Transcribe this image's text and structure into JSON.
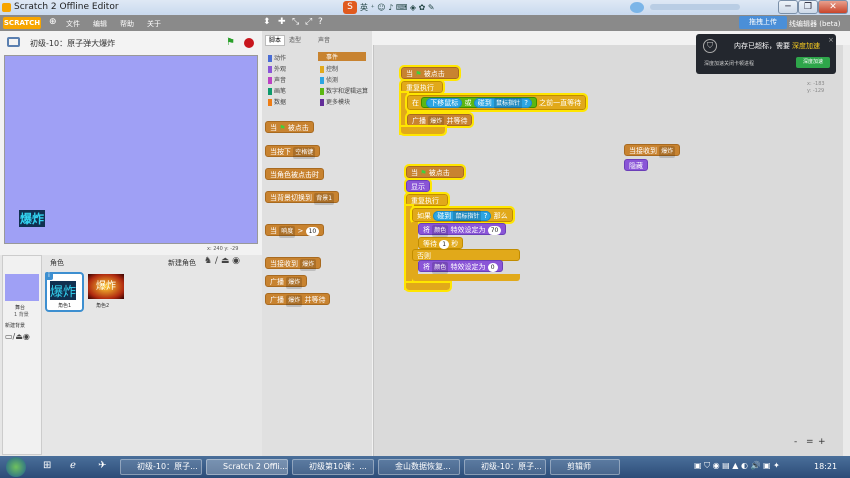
{
  "window": {
    "title": "Scratch 2 Offline Editor"
  },
  "menu": {
    "logo": "SCRATCH",
    "items": [
      "文件",
      "编辑",
      "帮助",
      "关于"
    ]
  },
  "project": {
    "title": "初级-10：原子弹大爆炸"
  },
  "stage": {
    "sprite_text": "爆炸",
    "coords": "x: 240  y: -29"
  },
  "sprites": {
    "header": "角色",
    "new_sprite": "新建角色",
    "list": [
      {
        "name": "角色1",
        "text": "爆炸"
      },
      {
        "name": "角色2",
        "text": "爆炸"
      }
    ],
    "stage_label": "舞台",
    "stage_sub": "1 背景",
    "new_backdrop": "新建背景"
  },
  "tabs": [
    "脚本",
    "造型",
    "声音"
  ],
  "categories": [
    {
      "label": "动作",
      "color": "#4a6cd4"
    },
    {
      "label": "事件",
      "color": "#c88330"
    },
    {
      "label": "外观",
      "color": "#8a55d7"
    },
    {
      "label": "控制",
      "color": "#e1a91a"
    },
    {
      "label": "声音",
      "color": "#bb42c3"
    },
    {
      "label": "侦测",
      "color": "#2ca5e2"
    },
    {
      "label": "画笔",
      "color": "#0e9a6c"
    },
    {
      "label": "数字和逻辑运算",
      "color": "#5cb712"
    },
    {
      "label": "数据",
      "color": "#ee7d16"
    },
    {
      "label": "更多模块",
      "color": "#632d99"
    }
  ],
  "palette_blocks": {
    "b1_when": "当",
    "b1_clicked": "被点击",
    "b2": "当按下",
    "b2_key": "空格键",
    "b3": "当角色被点击时",
    "b4": "当背景切换到",
    "b4_bg": "背景1",
    "b5": "当",
    "b5_sel": "响度",
    "b5_val": "10",
    "b6": "当接收到",
    "b6_msg": "爆炸",
    "b7": "广播",
    "b7_msg": "爆炸",
    "b8": "广播",
    "b8_msg": "爆炸",
    "b8_wait": "并等待"
  },
  "script1": {
    "when": "当",
    "clicked": "被点击",
    "forever": "重复执行",
    "in": "在",
    "key": "下移鼠标",
    "or": "或",
    "touching": "碰到",
    "target": "鼠标指针",
    "q": "?",
    "until": "之前一直等待",
    "broadcast": "广播",
    "msg": "爆炸",
    "wait": "并等待"
  },
  "script2": {
    "when": "当",
    "clicked": "被点击",
    "show": "显示",
    "forever": "重复执行",
    "if": "如果",
    "touching": "碰到",
    "target": "鼠标指针",
    "q": "?",
    "then": "那么",
    "set": "将",
    "effect": "颜色",
    "to": "特效设定为",
    "v1": "70",
    "wait_text": "等待",
    "wait_v": "1",
    "secs": "秒",
    "else": "否则",
    "set2": "将",
    "effect2": "颜色",
    "to2": "特效设定为",
    "v2": "0"
  },
  "script3": {
    "when": "当接收到",
    "msg": "爆炸",
    "hide": "隐藏"
  },
  "script_coords": {
    "x": "x: -183",
    "y": "y: -129"
  },
  "toast": {
    "title": "内存已超标，需要",
    "link": "深度加速",
    "sub": "深度加速关闭卡顿进程",
    "btn": "深度加速"
  },
  "upload": {
    "label": "拖拽上传",
    "suffix": "线编辑器 (beta)"
  },
  "zoom": {
    "out": "-",
    "reset": "=",
    "in": "+"
  },
  "taskbar": {
    "items": [
      "初级-10：原子...",
      "Scratch 2 Offli...",
      "初级第10课：...",
      "金山数据恢复...",
      "初级-10：原子...",
      "剪辑师"
    ],
    "time": "18:21"
  }
}
